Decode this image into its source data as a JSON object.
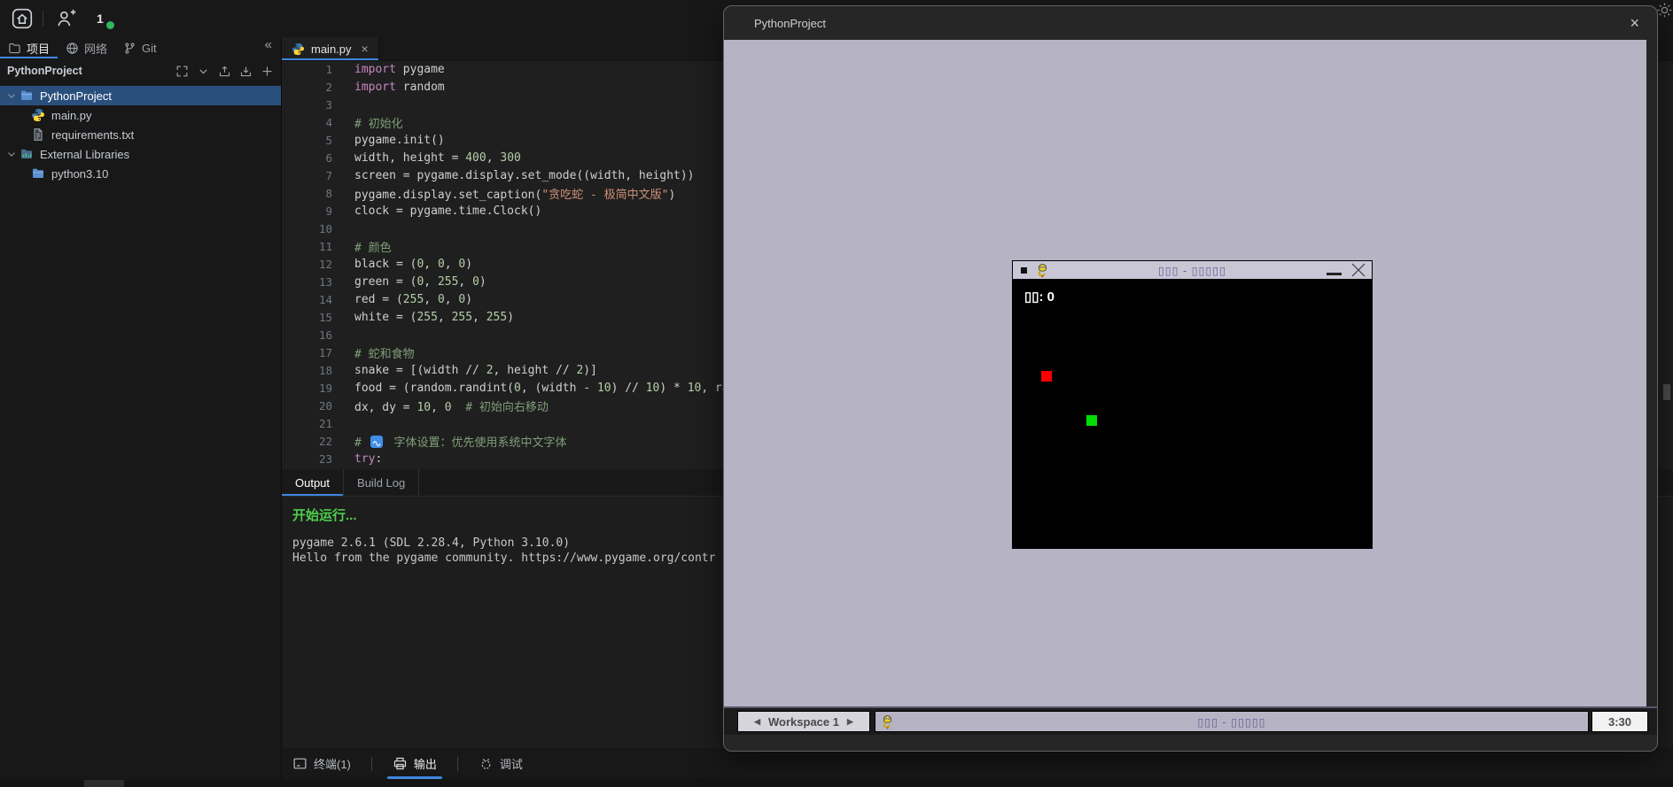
{
  "header": {
    "badge_count": "1"
  },
  "sidebar": {
    "collapse_label": "«",
    "panel_title": "PythonProject",
    "tabs": [
      {
        "id": "project",
        "label": "项目",
        "icon": "folder-tab-icon",
        "active": true
      },
      {
        "id": "network",
        "label": "网络",
        "icon": "globe-icon",
        "active": false
      },
      {
        "id": "git",
        "label": "Git",
        "icon": "git-branch-icon",
        "active": false
      }
    ],
    "panel_actions": [
      "expand-all-icon",
      "chevron-down-icon",
      "upload-icon",
      "download-icon",
      "add-icon"
    ],
    "tree": [
      {
        "label": "PythonProject",
        "icon": "folder-icon",
        "chevron": true,
        "selected": true,
        "indent": 0
      },
      {
        "label": "main.py",
        "icon": "python-icon",
        "chevron": false,
        "selected": false,
        "indent": 1
      },
      {
        "label": "requirements.txt",
        "icon": "file-icon",
        "chevron": false,
        "selected": false,
        "indent": 1
      },
      {
        "label": "External Libraries",
        "icon": "library-folder-icon",
        "chevron": true,
        "selected": false,
        "indent": 0
      },
      {
        "label": "python3.10",
        "icon": "folder-icon",
        "chevron": false,
        "selected": false,
        "indent": 1
      }
    ]
  },
  "editor": {
    "tab_label": "main.py",
    "tab_close_label": "×",
    "lines": [
      {
        "n": 1,
        "segs": [
          [
            "import",
            "kw"
          ],
          [
            " pygame",
            "def"
          ]
        ]
      },
      {
        "n": 2,
        "segs": [
          [
            "import",
            "kw"
          ],
          [
            " random",
            "def"
          ]
        ]
      },
      {
        "n": 3,
        "segs": []
      },
      {
        "n": 4,
        "segs": [
          [
            "# 初始化",
            "com"
          ]
        ]
      },
      {
        "n": 5,
        "segs": [
          [
            "pygame.init()",
            "def"
          ]
        ]
      },
      {
        "n": 6,
        "segs": [
          [
            "width, height = ",
            "def"
          ],
          [
            "400",
            "num"
          ],
          [
            ", ",
            "def"
          ],
          [
            "300",
            "num"
          ]
        ]
      },
      {
        "n": 7,
        "segs": [
          [
            "screen = pygame.display.set_mode((width, height))",
            "def"
          ]
        ]
      },
      {
        "n": 8,
        "segs": [
          [
            "pygame.display.set_caption(",
            "def"
          ],
          [
            "\"贪吃蛇 - 极简中文版\"",
            "str"
          ],
          [
            ")",
            "def"
          ]
        ]
      },
      {
        "n": 9,
        "segs": [
          [
            "clock = pygame.time.Clock()",
            "def"
          ]
        ]
      },
      {
        "n": 10,
        "segs": []
      },
      {
        "n": 11,
        "segs": [
          [
            "# 颜色",
            "com"
          ]
        ]
      },
      {
        "n": 12,
        "segs": [
          [
            "black = (",
            "def"
          ],
          [
            "0",
            "num"
          ],
          [
            ", ",
            "def"
          ],
          [
            "0",
            "num"
          ],
          [
            ", ",
            "def"
          ],
          [
            "0",
            "num"
          ],
          [
            ")",
            "def"
          ]
        ]
      },
      {
        "n": 13,
        "segs": [
          [
            "green = (",
            "def"
          ],
          [
            "0",
            "num"
          ],
          [
            ", ",
            "def"
          ],
          [
            "255",
            "num"
          ],
          [
            ", ",
            "def"
          ],
          [
            "0",
            "num"
          ],
          [
            ")",
            "def"
          ]
        ]
      },
      {
        "n": 14,
        "segs": [
          [
            "red = (",
            "def"
          ],
          [
            "255",
            "num"
          ],
          [
            ", ",
            "def"
          ],
          [
            "0",
            "num"
          ],
          [
            ", ",
            "def"
          ],
          [
            "0",
            "num"
          ],
          [
            ")",
            "def"
          ]
        ]
      },
      {
        "n": 15,
        "segs": [
          [
            "white = (",
            "def"
          ],
          [
            "255",
            "num"
          ],
          [
            ", ",
            "def"
          ],
          [
            "255",
            "num"
          ],
          [
            ", ",
            "def"
          ],
          [
            "255",
            "num"
          ],
          [
            ")",
            "def"
          ]
        ]
      },
      {
        "n": 16,
        "segs": []
      },
      {
        "n": 17,
        "segs": [
          [
            "# 蛇和食物",
            "com"
          ]
        ]
      },
      {
        "n": 18,
        "segs": [
          [
            "snake = [(width // ",
            "def"
          ],
          [
            "2",
            "num"
          ],
          [
            ", height // ",
            "def"
          ],
          [
            "2",
            "num"
          ],
          [
            ")]",
            "def"
          ]
        ]
      },
      {
        "n": 19,
        "segs": [
          [
            "food = (random.randint(",
            "def"
          ],
          [
            "0",
            "num"
          ],
          [
            ", (width - ",
            "def"
          ],
          [
            "10",
            "num"
          ],
          [
            ") // ",
            "def"
          ],
          [
            "10",
            "num"
          ],
          [
            ") * ",
            "def"
          ],
          [
            "10",
            "num"
          ],
          [
            ", ra",
            "def"
          ]
        ]
      },
      {
        "n": 20,
        "segs": [
          [
            "dx, dy = ",
            "def"
          ],
          [
            "10",
            "num"
          ],
          [
            ", ",
            "def"
          ],
          [
            "0",
            "num"
          ],
          [
            "  ",
            "def"
          ],
          [
            "# 初始向右移动",
            "com"
          ]
        ]
      },
      {
        "n": 21,
        "segs": []
      },
      {
        "n": 22,
        "segs": [
          [
            "# ",
            "com"
          ],
          [
            "",
            "icon"
          ],
          [
            " 字体设置：优先使用系统中文字体",
            "com"
          ]
        ]
      },
      {
        "n": 23,
        "segs": [
          [
            "try",
            "kw"
          ],
          [
            ":",
            "def"
          ]
        ]
      }
    ]
  },
  "output": {
    "tabs": [
      {
        "label": "Output",
        "active": true
      },
      {
        "label": "Build Log",
        "active": false
      }
    ],
    "lines": [
      {
        "text": "开始运行...",
        "style": "start"
      },
      {
        "text": "",
        "style": "blank"
      },
      {
        "text": "pygame 2.6.1 (SDL 2.28.4, Python 3.10.0)",
        "style": "mono"
      },
      {
        "text": "Hello from the pygame community. https://www.pygame.org/contr",
        "style": "mono"
      }
    ]
  },
  "bottom_bar": {
    "items": [
      {
        "label": "终端(1)",
        "icon": "terminal-icon",
        "active": false
      },
      {
        "label": "输出",
        "icon": "printer-icon",
        "active": true
      },
      {
        "label": "调试",
        "icon": "debug-icon",
        "active": false
      }
    ]
  },
  "floating_window": {
    "title": "PythonProject",
    "close_label": "×",
    "game_window": {
      "title": "▯▯▯ - ▯▯▯▯▯",
      "score": "▯▯: 0"
    },
    "taskbar": {
      "prev": "◀",
      "workspace": "Workspace 1",
      "next": "▶",
      "task_title": "▯▯▯ - ▯▯▯▯▯",
      "clock": "3:30"
    }
  },
  "colors": {
    "accent": "#3f86e0",
    "tree_selection": "#2b4f7d",
    "desktop_lavender": "#b6b4c4",
    "log_green": "#4ccf4c",
    "snake_red": "#ff0000",
    "food_green": "#00dd00",
    "keyword": "#c586c0",
    "number": "#b5cea8",
    "string": "#ce9178",
    "comment": "#7f9f78"
  }
}
